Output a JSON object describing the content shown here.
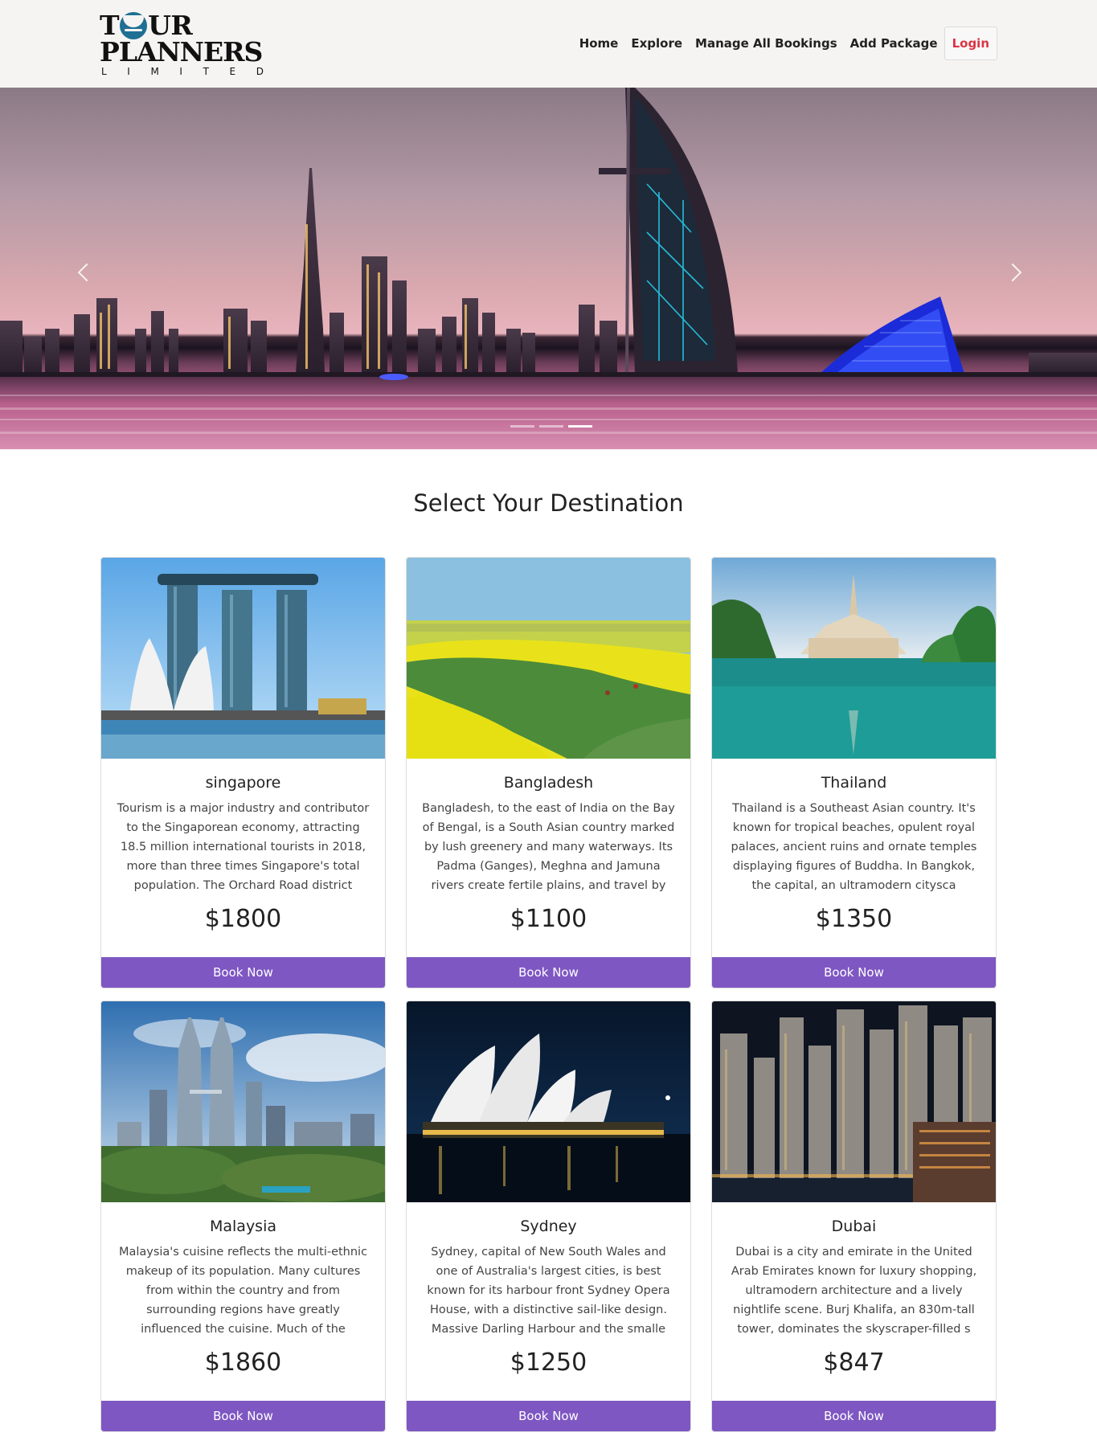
{
  "brand": {
    "line1_start": "T",
    "line1_end": "UR",
    "line2": "PLANNERS",
    "line3": [
      "L",
      "I",
      "M",
      "I",
      "T",
      "E",
      "D"
    ]
  },
  "nav": {
    "items": [
      "Home",
      "Explore",
      "Manage All Bookings",
      "Add Package"
    ],
    "login": "Login"
  },
  "hero": {
    "slide_count": 3,
    "active_slide": 3
  },
  "section_title": "Select Your Destination",
  "packages": [
    {
      "name": "singapore",
      "description": "Tourism is a major industry and contributor to the Singaporean economy, attracting 18.5 million international tourists in 2018, more than three times Singapore's total population. The Orchard Road district",
      "price": "$1800",
      "button": "Book Now"
    },
    {
      "name": "Bangladesh",
      "description": "Bangladesh, to the east of India on the Bay of Bengal, is a South Asian country marked by lush greenery and many waterways. Its Padma (Ganges), Meghna and Jamuna rivers create fertile plains, and travel by",
      "price": "$1100",
      "button": "Book Now"
    },
    {
      "name": "Thailand",
      "description": "Thailand is a Southeast Asian country. It's known for tropical beaches, opulent royal palaces, ancient ruins and ornate temples displaying figures of Buddha. In Bangkok, the capital, an ultramodern citysca",
      "price": "$1350",
      "button": "Book Now"
    },
    {
      "name": "Malaysia",
      "description": "Malaysia's cuisine reflects the multi-ethnic makeup of its population. Many cultures from within the country and from surrounding regions have greatly influenced the cuisine. Much of the influence comes fr",
      "price": "$1860",
      "button": "Book Now"
    },
    {
      "name": "Sydney",
      "description": "Sydney, capital of New South Wales and one of Australia's largest cities, is best known for its harbour front Sydney Opera House, with a distinctive sail-like design. Massive Darling Harbour and the smalle",
      "price": "$1250",
      "button": "Book Now"
    },
    {
      "name": "Dubai",
      "description": "Dubai is a city and emirate in the United Arab Emirates known for luxury shopping, ultramodern architecture and a lively nightlife scene. Burj Khalifa, an 830m-tall tower, dominates the skyscraper-filled s",
      "price": "$847",
      "button": "Book Now"
    }
  ],
  "colors": {
    "accent": "#7e57c2",
    "login": "#dc3545",
    "header_bg": "#f5f4f2"
  }
}
